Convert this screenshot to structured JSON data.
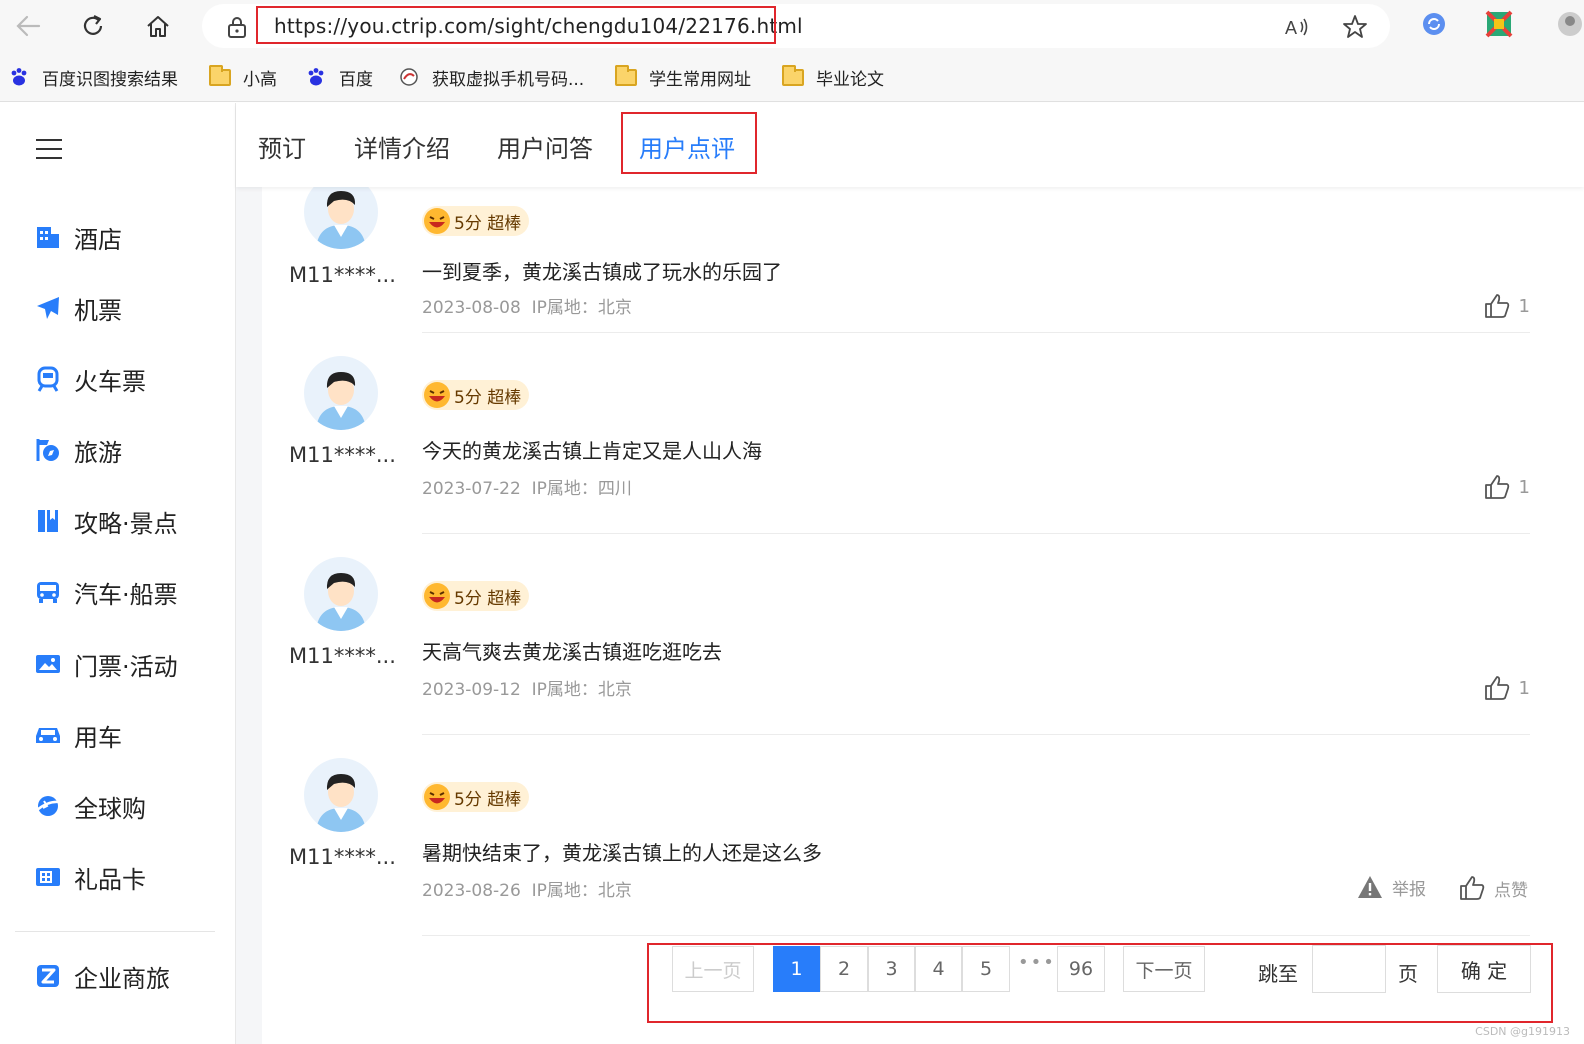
{
  "browser": {
    "url": "https://you.ctrip.com/sight/chengdu104/22176.html",
    "icons": [
      "back-arrow-icon",
      "refresh-icon",
      "home-icon",
      "lock-icon",
      "read-aloud-icon",
      "favorite-star-icon",
      "sync-extension-icon",
      "extension-icon"
    ]
  },
  "bookmarks": [
    {
      "label": "百度识图搜索结果",
      "icon": "baidu-paw-icon"
    },
    {
      "label": "小高",
      "icon": "folder-icon"
    },
    {
      "label": "百度",
      "icon": "baidu-paw-icon"
    },
    {
      "label": "获取虚拟手机号码...",
      "icon": "site-icon"
    },
    {
      "label": "学生常用网址",
      "icon": "folder-icon"
    },
    {
      "label": "毕业论文",
      "icon": "folder-icon"
    }
  ],
  "sidebar": {
    "items": [
      {
        "label": "酒店",
        "icon": "hotel-icon"
      },
      {
        "label": "机票",
        "icon": "plane-icon"
      },
      {
        "label": "火车票",
        "icon": "train-icon"
      },
      {
        "label": "旅游",
        "icon": "travel-icon"
      },
      {
        "label": "攻略·景点",
        "icon": "guide-icon"
      },
      {
        "label": "汽车·船票",
        "icon": "bus-icon"
      },
      {
        "label": "门票·活动",
        "icon": "ticket-icon"
      },
      {
        "label": "用车",
        "icon": "car-icon"
      },
      {
        "label": "全球购",
        "icon": "global-shop-icon"
      },
      {
        "label": "礼品卡",
        "icon": "gift-card-icon"
      }
    ],
    "corporate": {
      "label": "企业商旅",
      "icon": "business-icon"
    }
  },
  "tabs": [
    {
      "label": "预订",
      "active": false
    },
    {
      "label": "详情介绍",
      "active": false
    },
    {
      "label": "用户问答",
      "active": false
    },
    {
      "label": "用户点评",
      "active": true
    }
  ],
  "reviews": [
    {
      "user": "M11****...",
      "score": "5分 超棒",
      "text": "一到夏季，黄龙溪古镇成了玩水的乐园了",
      "date": "2023-08-08",
      "ip": "IP属地：北京",
      "likes": "1"
    },
    {
      "user": "M11****...",
      "score": "5分 超棒",
      "text": "今天的黄龙溪古镇上肯定又是人山人海",
      "date": "2023-07-22",
      "ip": "IP属地：四川",
      "likes": "1"
    },
    {
      "user": "M11****...",
      "score": "5分 超棒",
      "text": "天高气爽去黄龙溪古镇逛吃逛吃去",
      "date": "2023-09-12",
      "ip": "IP属地：北京",
      "likes": "1"
    },
    {
      "user": "M11****...",
      "score": "5分 超棒",
      "text": "暑期快结束了，黄龙溪古镇上的人还是这么多",
      "date": "2023-08-26",
      "ip": "IP属地：北京",
      "report_label": "举报",
      "like_label": "点赞"
    }
  ],
  "pagination": {
    "prev": "上一页",
    "pages": [
      "1",
      "2",
      "3",
      "4",
      "5"
    ],
    "current": "1",
    "ellipsis": "•••",
    "last": "96",
    "next": "下一页",
    "jump_label": "跳至",
    "page_unit": "页",
    "confirm": "确 定"
  },
  "watermark": "CSDN @g191913",
  "colors": {
    "accent": "#287dfa",
    "highlight_box": "#e0262c"
  }
}
